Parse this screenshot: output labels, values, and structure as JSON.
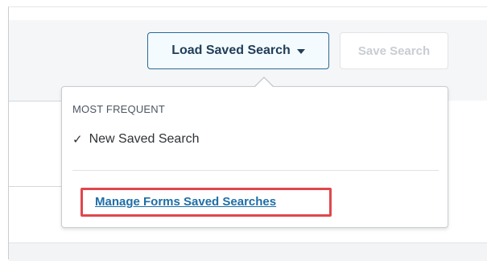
{
  "toolbar": {
    "load_label": "Load Saved Search",
    "save_label": "Save Search"
  },
  "dropdown": {
    "section_heading": "MOST FREQUENT",
    "items": [
      {
        "label": "New Saved Search",
        "checked": true,
        "check_glyph": "✓"
      }
    ],
    "manage_link": "Manage Forms Saved Searches"
  },
  "icons": {
    "caret": "chevron-down-icon",
    "check": "checkmark-icon"
  },
  "colors": {
    "accent": "#2a6a98",
    "link": "#1e6ea7",
    "highlight_border": "#e0474c",
    "disabled_text": "#c9cdd2"
  }
}
